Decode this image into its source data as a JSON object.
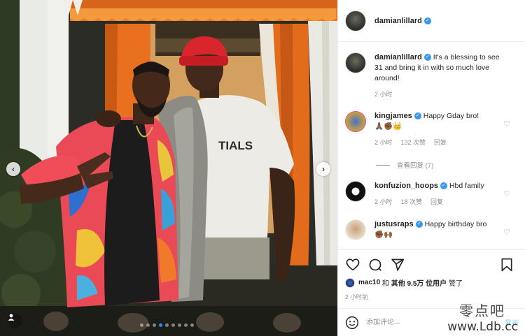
{
  "post_author": {
    "username": "damianlillard",
    "verified": true
  },
  "photo": {
    "shirt_text": "TIALS",
    "carousel_dot_count": 9,
    "carousel_active_index": 3
  },
  "caption": {
    "username": "damianlillard",
    "text": "It's a blessing to see 31 and bring it in with so much love around!",
    "time": "2 小时"
  },
  "comments": [
    {
      "username": "kingjames",
      "verified": true,
      "text": "Happy Gday bro!",
      "emoji": "🙏🏾✊🏾👑",
      "time": "2 小时",
      "likes": "132 次赞",
      "reply_label": "回复"
    },
    {
      "username": "konfuzion_hoops",
      "verified": true,
      "text": "Hbd family",
      "time": "2 小时",
      "likes": "18 次赞",
      "reply_label": "回复"
    },
    {
      "username": "justusraps",
      "verified": true,
      "text": "Happy birthday bro",
      "emoji": "✊🏾🙌🏾"
    }
  ],
  "view_replies_label": "查看回复 (7)",
  "likes_summary": {
    "first_user": "mac10",
    "connector": "和",
    "others": "其他 9.5万 位用户",
    "suffix": "赞了"
  },
  "post_time": "2 小时前",
  "add_comment": {
    "placeholder": "添加评论...",
    "post_label": "发布"
  },
  "watermark": {
    "line1": "零点吧",
    "line2": "www.Ldb.cc"
  },
  "icons": {
    "like": "heart-icon",
    "comment": "comment-icon",
    "share": "share-icon",
    "save": "bookmark-icon",
    "emoji": "smiley-icon",
    "prev": "chevron-left-icon",
    "next": "chevron-right-icon",
    "tags": "user-tag-icon"
  },
  "colors": {
    "verified": "#3897f0",
    "carousel_active": "#2f8af5",
    "awning_orange": "#e8701f",
    "muted_text": "#8e8e8e"
  }
}
